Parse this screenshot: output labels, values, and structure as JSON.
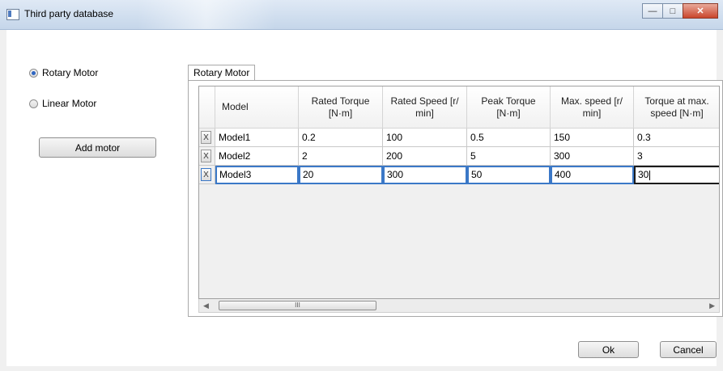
{
  "window": {
    "title": "Third party database",
    "controls": {
      "minimize_icon": "minimize-icon",
      "maximize_icon": "maximize-icon",
      "close_icon": "close-icon"
    }
  },
  "motor_type": {
    "options": [
      {
        "label": "Rotary Motor",
        "checked": true
      },
      {
        "label": "Linear Motor",
        "checked": false
      }
    ]
  },
  "add_motor_label": "Add motor",
  "tab": {
    "label": "Rotary Motor"
  },
  "grid": {
    "columns": [
      "Model",
      "Rated Torque [N·m]",
      "Rated Speed [r/ min]",
      "Peak Torque [N·m]",
      "Max. speed [r/ min]",
      "Torque at max. speed [N·m]"
    ],
    "delete_glyph": "X",
    "rows": [
      [
        "Model1",
        "0.2",
        "100",
        "0.5",
        "150",
        "0.3"
      ],
      [
        "Model2",
        "2",
        "200",
        "5",
        "300",
        "3"
      ],
      [
        "Model3",
        "20",
        "300",
        "50",
        "400",
        "30"
      ]
    ],
    "scroll_grip": "III"
  },
  "footer": {
    "ok_label": "Ok",
    "cancel_label": "Cancel"
  },
  "colors": {
    "selection": "#3b78c7",
    "radio_dot": "#2f66c2",
    "close_button": "#c9452c"
  }
}
